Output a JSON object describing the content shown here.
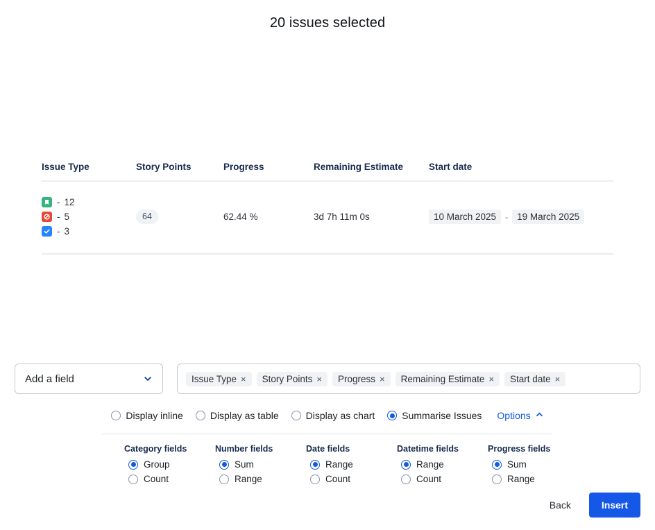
{
  "header": {
    "title": "20 issues selected"
  },
  "summary_table": {
    "columns": [
      {
        "key": "issue_type",
        "label": "Issue Type"
      },
      {
        "key": "story_points",
        "label": "Story Points"
      },
      {
        "key": "progress",
        "label": "Progress"
      },
      {
        "key": "remaining_estimate",
        "label": "Remaining Estimate"
      },
      {
        "key": "start_date",
        "label": "Start date"
      }
    ],
    "row": {
      "issue_types": [
        {
          "icon": "story-icon",
          "color": "#36b37e",
          "separator": "-",
          "count": "12"
        },
        {
          "icon": "blocked-icon",
          "color": "#e5493a",
          "separator": "-",
          "count": "5"
        },
        {
          "icon": "task-icon",
          "color": "#2684ff",
          "separator": "-",
          "count": "3"
        }
      ],
      "story_points": "64",
      "progress": "62.44 %",
      "remaining_estimate": "3d 7h 11m 0s",
      "start_date_from": "10 March 2025",
      "start_date_dash": "-",
      "start_date_to": "19 March 2025"
    }
  },
  "field_picker": {
    "add_field_label": "Add a field",
    "add_field_icon": "chevron-down-icon",
    "chips": [
      {
        "label": "Issue Type",
        "remove": "×"
      },
      {
        "label": "Story Points",
        "remove": "×"
      },
      {
        "label": "Progress",
        "remove": "×"
      },
      {
        "label": "Remaining Estimate",
        "remove": "×"
      },
      {
        "label": "Start date",
        "remove": "×"
      }
    ]
  },
  "display_modes": {
    "items": [
      {
        "label": "Display inline",
        "selected": false
      },
      {
        "label": "Display as table",
        "selected": false
      },
      {
        "label": "Display as chart",
        "selected": false
      },
      {
        "label": "Summarise Issues",
        "selected": true
      }
    ],
    "options_label": "Options",
    "options_icon": "chevron-up-icon",
    "options_expanded": true
  },
  "options_panel": {
    "groups": [
      {
        "title": "Category fields",
        "choices": [
          {
            "label": "Group",
            "selected": true
          },
          {
            "label": "Count",
            "selected": false
          }
        ]
      },
      {
        "title": "Number fields",
        "choices": [
          {
            "label": "Sum",
            "selected": true
          },
          {
            "label": "Range",
            "selected": false
          }
        ]
      },
      {
        "title": "Date fields",
        "choices": [
          {
            "label": "Range",
            "selected": true
          },
          {
            "label": "Count",
            "selected": false
          }
        ]
      },
      {
        "title": "Datetime fields",
        "choices": [
          {
            "label": "Range",
            "selected": true
          },
          {
            "label": "Count",
            "selected": false
          }
        ]
      },
      {
        "title": "Progress fields",
        "choices": [
          {
            "label": "Sum",
            "selected": true
          },
          {
            "label": "Range",
            "selected": false
          }
        ]
      }
    ]
  },
  "footer": {
    "back_label": "Back",
    "insert_label": "Insert",
    "insert_color": "#1558e8"
  }
}
